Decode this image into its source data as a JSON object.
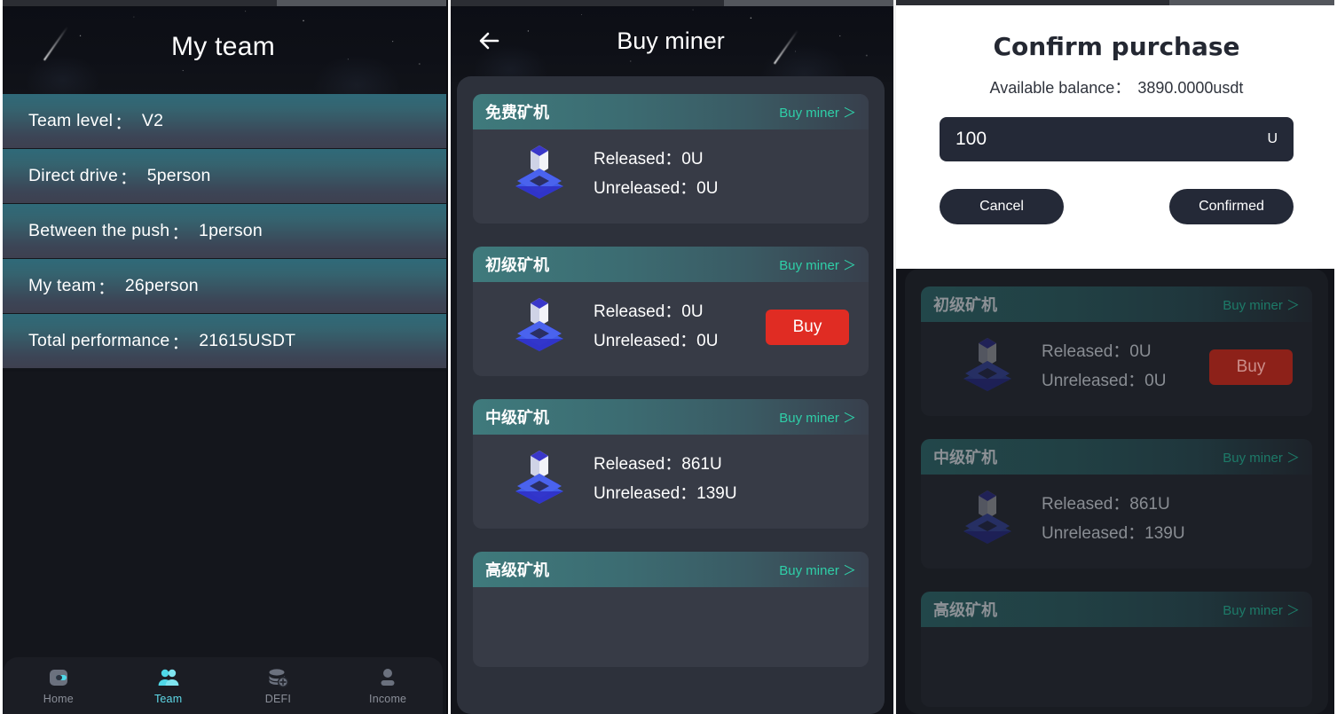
{
  "left_panel": {
    "header_title": "My team",
    "rows": [
      {
        "label": "Team level",
        "sep": "：",
        "value": "V2"
      },
      {
        "label": "Direct drive",
        "sep": "：",
        "value": "5person"
      },
      {
        "label": "Between the push",
        "sep": "：",
        "value": "1person"
      },
      {
        "label": "My team",
        "sep": " ：",
        "value": "26person"
      },
      {
        "label": "Total performance",
        "sep": "：",
        "value": "21615USDT"
      }
    ],
    "tabbar": [
      {
        "icon": "home-icon",
        "label": "Home",
        "active": false
      },
      {
        "icon": "team-icon",
        "label": "Team",
        "active": true
      },
      {
        "icon": "defi-icon",
        "label": "DEFI",
        "active": false
      },
      {
        "icon": "income-icon",
        "label": "Income",
        "active": false
      }
    ]
  },
  "mid_panel": {
    "back_icon": "back-arrow-icon",
    "header_title": "Buy miner",
    "cards": [
      {
        "title": "免费矿机",
        "link": "Buy miner ＞",
        "released_label": "Released：",
        "released_value": "0U",
        "unreleased_label": "Unreleased：",
        "unreleased_value": "0U",
        "buy_label": "",
        "has_buy": false
      },
      {
        "title": "初级矿机",
        "link": "Buy miner ＞",
        "released_label": "Released：",
        "released_value": "0U",
        "unreleased_label": "Unreleased：",
        "unreleased_value": "0U",
        "buy_label": "Buy",
        "has_buy": true
      },
      {
        "title": "中级矿机",
        "link": "Buy miner ＞",
        "released_label": "Released：",
        "released_value": "861U",
        "unreleased_label": "Unreleased：",
        "unreleased_value": "139U",
        "buy_label": "",
        "has_buy": false
      },
      {
        "title": "高级矿机",
        "link": "Buy miner ＞",
        "released_label": "Released：",
        "released_value": "",
        "unreleased_label": "Unreleased：",
        "unreleased_value": "",
        "buy_label": "",
        "has_buy": false
      }
    ]
  },
  "right_panel": {
    "dialog": {
      "title": "Confirm purchase",
      "balance_label": "Available balance：",
      "balance_value": "3890.0000usdt",
      "amount_value": "100",
      "amount_placeholder": "100",
      "unit": "U",
      "cancel_label": "Cancel",
      "confirm_label": "Confirmed"
    },
    "cards": [
      {
        "title": "初级矿机",
        "link": "Buy miner ＞",
        "released_label": "Released：",
        "released_value": "0U",
        "unreleased_label": "Unreleased：",
        "unreleased_value": "0U",
        "buy_label": "Buy",
        "has_buy": true
      },
      {
        "title": "中级矿机",
        "link": "Buy miner ＞",
        "released_label": "Released：",
        "released_value": "861U",
        "unreleased_label": "Unreleased：",
        "unreleased_value": "139U",
        "buy_label": "",
        "has_buy": false
      },
      {
        "title": "高级矿机",
        "link": "Buy miner ＞",
        "released_label": "Released：",
        "released_value": "",
        "unreleased_label": "Unreleased：",
        "unreleased_value": "",
        "buy_label": "",
        "has_buy": false
      }
    ]
  },
  "colors": {
    "accent_teal": "#2fcfa8",
    "tab_active": "#5fd9e8",
    "buy_red": "#e02c23",
    "row_teal": "#2f6a79",
    "dialog_bg": "#ffffff",
    "input_bg": "#242937"
  }
}
